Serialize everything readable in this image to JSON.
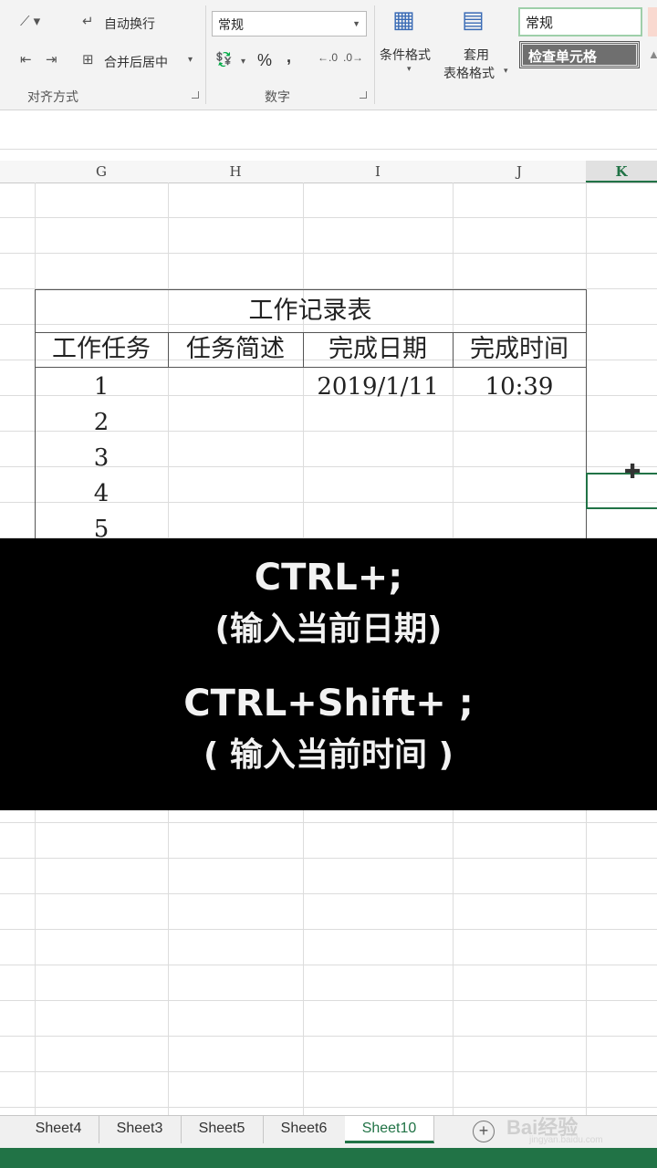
{
  "ribbon": {
    "wrap_text": "自动换行",
    "merge_center": "合并后居中",
    "alignment_group": "对齐方式",
    "number_format_value": "常规",
    "percent": "%",
    "comma": ",",
    "number_group": "数字",
    "conditional_format": "条件格式",
    "format_as_table_1": "套用",
    "format_as_table_2": "表格格式",
    "style_normal": "常规",
    "style_check_cell": "检查单元格"
  },
  "columns": [
    "G",
    "H",
    "I",
    "J",
    "K"
  ],
  "selected_column": "K",
  "table": {
    "title": "工作记录表",
    "headers": [
      "工作任务",
      "任务简述",
      "完成日期",
      "完成时间"
    ],
    "rows": [
      {
        "task": "1",
        "desc": "",
        "date": "2019/1/11",
        "time": "10:39"
      },
      {
        "task": "2",
        "desc": "",
        "date": "",
        "time": ""
      },
      {
        "task": "3",
        "desc": "",
        "date": "",
        "time": ""
      },
      {
        "task": "4",
        "desc": "",
        "date": "",
        "time": ""
      },
      {
        "task": "5",
        "desc": "",
        "date": "",
        "time": ""
      }
    ]
  },
  "overlay": {
    "line1": "CTRL+;",
    "line2": "(输入当前日期)",
    "line3": "CTRL+Shift+ ;",
    "line4": "( 输入当前时间 )"
  },
  "sheets": [
    "Sheet4",
    "Sheet3",
    "Sheet5",
    "Sheet6",
    "Sheet10"
  ],
  "active_sheet": "Sheet10",
  "watermark": {
    "brand": "Bai经验",
    "url": "jingyan.baidu.com"
  },
  "colors": {
    "excel_green": "#217346",
    "overlay": "#000000"
  }
}
